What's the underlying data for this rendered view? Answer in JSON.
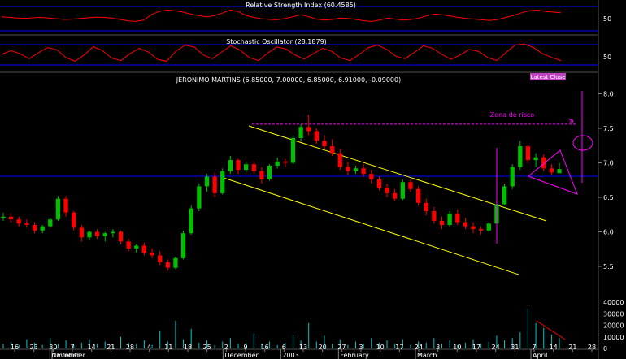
{
  "chart_data": {
    "type": "candlestick",
    "title": "JERONIMO MARTINS (6.85000, 7.00000, 6.85000, 6.91000, -0.09000)",
    "badge": "Latest Close",
    "annotation": "Zona de risco",
    "colors": {
      "background": "#000000",
      "up": "#00c000",
      "down": "#ff0000",
      "oscillator": "#ff0000",
      "reference": "#0000ff",
      "channel": "#ffff00",
      "highlight": "#ff00ff",
      "volume": "#00c8c8"
    },
    "price_axis": {
      "ylim": [
        5.3,
        8.3
      ],
      "ticks": [
        "5.5",
        "6.0",
        "6.5",
        "7.0",
        "7.5",
        "8.0"
      ]
    },
    "rsi": {
      "label": "Relative Strength Index (60.4585)",
      "tick": "50",
      "values": [
        52,
        50,
        48,
        47,
        49,
        50,
        48,
        46,
        44,
        45,
        47,
        49,
        51,
        50,
        48,
        44,
        40,
        38,
        42,
        58,
        68,
        72,
        70,
        66,
        60,
        55,
        52,
        55,
        63,
        72,
        68,
        56,
        50,
        46,
        44,
        43,
        47,
        52,
        58,
        52,
        45,
        42,
        44,
        48,
        47,
        44,
        40,
        38,
        42,
        48,
        45,
        42,
        44,
        48,
        55,
        60,
        58,
        54,
        50,
        47,
        45,
        43,
        41,
        44,
        50,
        56,
        64,
        70,
        72,
        68,
        66,
        64
      ]
    },
    "stochastic": {
      "label": "Stochastic Oscillator (28.1879)",
      "tick": "50",
      "values": [
        50,
        62,
        52,
        36,
        55,
        72,
        65,
        40,
        28,
        48,
        75,
        62,
        38,
        30,
        52,
        70,
        58,
        34,
        28,
        60,
        80,
        74,
        48,
        36,
        58,
        78,
        64,
        40,
        30,
        54,
        74,
        68,
        48,
        35,
        52,
        70,
        60,
        38,
        30,
        50,
        72,
        80,
        66,
        44,
        36,
        56,
        78,
        70,
        50,
        34,
        48,
        66,
        60,
        40,
        30,
        56,
        80,
        84,
        72,
        52,
        40,
        30
      ]
    },
    "candles": [
      [
        6.2,
        6.28,
        6.16,
        6.22
      ],
      [
        6.22,
        6.26,
        6.14,
        6.18
      ],
      [
        6.18,
        6.22,
        6.08,
        6.12
      ],
      [
        6.12,
        6.18,
        6.06,
        6.1
      ],
      [
        6.1,
        6.14,
        5.98,
        6.02
      ],
      [
        6.02,
        6.1,
        5.98,
        6.08
      ],
      [
        6.08,
        6.2,
        6.06,
        6.18
      ],
      [
        6.18,
        6.52,
        6.16,
        6.48
      ],
      [
        6.48,
        6.52,
        6.22,
        6.28
      ],
      [
        6.28,
        6.3,
        6.02,
        6.06
      ],
      [
        6.06,
        6.1,
        5.86,
        5.92
      ],
      [
        5.92,
        6.02,
        5.88,
        6.0
      ],
      [
        6.0,
        6.04,
        5.9,
        5.94
      ],
      [
        5.94,
        6.0,
        5.86,
        5.98
      ],
      [
        5.98,
        6.04,
        5.92,
        6.0
      ],
      [
        6.0,
        6.02,
        5.82,
        5.86
      ],
      [
        5.86,
        5.9,
        5.72,
        5.76
      ],
      [
        5.76,
        5.82,
        5.7,
        5.8
      ],
      [
        5.8,
        5.84,
        5.66,
        5.7
      ],
      [
        5.7,
        5.76,
        5.62,
        5.66
      ],
      [
        5.66,
        5.72,
        5.52,
        5.56
      ],
      [
        5.56,
        5.6,
        5.44,
        5.48
      ],
      [
        5.48,
        5.64,
        5.46,
        5.62
      ],
      [
        5.62,
        6.02,
        5.6,
        5.98
      ],
      [
        5.98,
        6.38,
        5.96,
        6.34
      ],
      [
        6.34,
        6.7,
        6.3,
        6.66
      ],
      [
        6.66,
        6.84,
        6.58,
        6.8
      ],
      [
        6.8,
        6.86,
        6.5,
        6.56
      ],
      [
        6.56,
        6.92,
        6.54,
        6.88
      ],
      [
        6.88,
        7.1,
        6.84,
        7.04
      ],
      [
        7.04,
        7.06,
        6.84,
        6.9
      ],
      [
        6.9,
        7.02,
        6.86,
        6.98
      ],
      [
        6.98,
        7.02,
        6.84,
        6.88
      ],
      [
        6.88,
        6.94,
        6.7,
        6.76
      ],
      [
        6.76,
        6.98,
        6.74,
        6.96
      ],
      [
        6.96,
        7.08,
        6.92,
        7.02
      ],
      [
        7.02,
        7.06,
        6.94,
        7.0
      ],
      [
        7.0,
        7.4,
        6.98,
        7.36
      ],
      [
        7.36,
        7.56,
        7.32,
        7.52
      ],
      [
        7.52,
        7.7,
        7.4,
        7.46
      ],
      [
        7.46,
        7.5,
        7.28,
        7.32
      ],
      [
        7.32,
        7.4,
        7.2,
        7.24
      ],
      [
        7.24,
        7.34,
        7.1,
        7.14
      ],
      [
        7.14,
        7.2,
        6.9,
        6.94
      ],
      [
        6.94,
        7.02,
        6.82,
        6.88
      ],
      [
        6.88,
        6.96,
        6.84,
        6.92
      ],
      [
        6.92,
        6.98,
        6.8,
        6.84
      ],
      [
        6.84,
        6.9,
        6.7,
        6.76
      ],
      [
        6.76,
        6.8,
        6.6,
        6.64
      ],
      [
        6.64,
        6.7,
        6.5,
        6.56
      ],
      [
        6.56,
        6.62,
        6.44,
        6.48
      ],
      [
        6.48,
        6.76,
        6.46,
        6.72
      ],
      [
        6.72,
        6.76,
        6.58,
        6.62
      ],
      [
        6.62,
        6.66,
        6.38,
        6.42
      ],
      [
        6.42,
        6.48,
        6.24,
        6.3
      ],
      [
        6.3,
        6.36,
        6.12,
        6.16
      ],
      [
        6.16,
        6.22,
        6.04,
        6.1
      ],
      [
        6.1,
        6.3,
        6.08,
        6.26
      ],
      [
        6.26,
        6.32,
        6.1,
        6.14
      ],
      [
        6.14,
        6.2,
        6.04,
        6.08
      ],
      [
        6.08,
        6.14,
        5.98,
        6.04
      ],
      [
        6.04,
        6.08,
        5.96,
        6.02
      ],
      [
        6.02,
        6.14,
        6.0,
        6.12
      ],
      [
        6.12,
        6.44,
        6.1,
        6.4
      ],
      [
        6.4,
        6.7,
        6.38,
        6.66
      ],
      [
        6.66,
        6.98,
        6.62,
        6.94
      ],
      [
        6.94,
        7.32,
        6.9,
        7.24
      ],
      [
        7.24,
        7.26,
        7.0,
        7.04
      ],
      [
        7.04,
        7.14,
        6.94,
        7.08
      ],
      [
        7.08,
        7.12,
        6.88,
        6.92
      ],
      [
        6.92,
        6.98,
        6.82,
        6.86
      ],
      [
        6.85,
        7.0,
        6.85,
        6.91
      ]
    ],
    "volume_axis": {
      "ylim": [
        0,
        50000
      ],
      "ticks": [
        "40000",
        "30000",
        "20000",
        "10000",
        "0"
      ]
    },
    "volume": [
      4000,
      6000,
      3000,
      8000,
      5000,
      3000,
      9000,
      4000,
      7000,
      3000,
      5000,
      8000,
      4000,
      6000,
      3000,
      10000,
      5000,
      4000,
      7000,
      3000,
      15000,
      6000,
      24000,
      8000,
      17000,
      5000,
      7000,
      3000,
      6000,
      9000,
      4000,
      5000,
      13000,
      4000,
      6000,
      3000,
      5000,
      12000,
      7000,
      22000,
      6000,
      11000,
      4000,
      8000,
      3000,
      6000,
      4000,
      9000,
      5000,
      7000,
      4000,
      8000,
      3000,
      6000,
      5000,
      9000,
      4000,
      7000,
      3000,
      5000,
      8000,
      4000,
      6000,
      11000,
      7000,
      9000,
      14000,
      35000,
      22000,
      18000,
      12000,
      9000
    ],
    "x_axis": {
      "days": [
        "16",
        "23",
        "30",
        "7",
        "14",
        "21",
        "28",
        "4",
        "11",
        "18",
        "25",
        "2",
        "9",
        "16",
        "6",
        "13",
        "20",
        "27",
        "3",
        "10",
        "17",
        "24",
        "3",
        "10",
        "17",
        "24",
        "31",
        "7",
        "14",
        "21",
        "28"
      ],
      "months": [
        "October",
        "November",
        "December",
        "2003",
        "February",
        "March",
        "April"
      ]
    },
    "risk_level": 7.56,
    "oscillator_markers": [
      "70",
      "30"
    ]
  }
}
